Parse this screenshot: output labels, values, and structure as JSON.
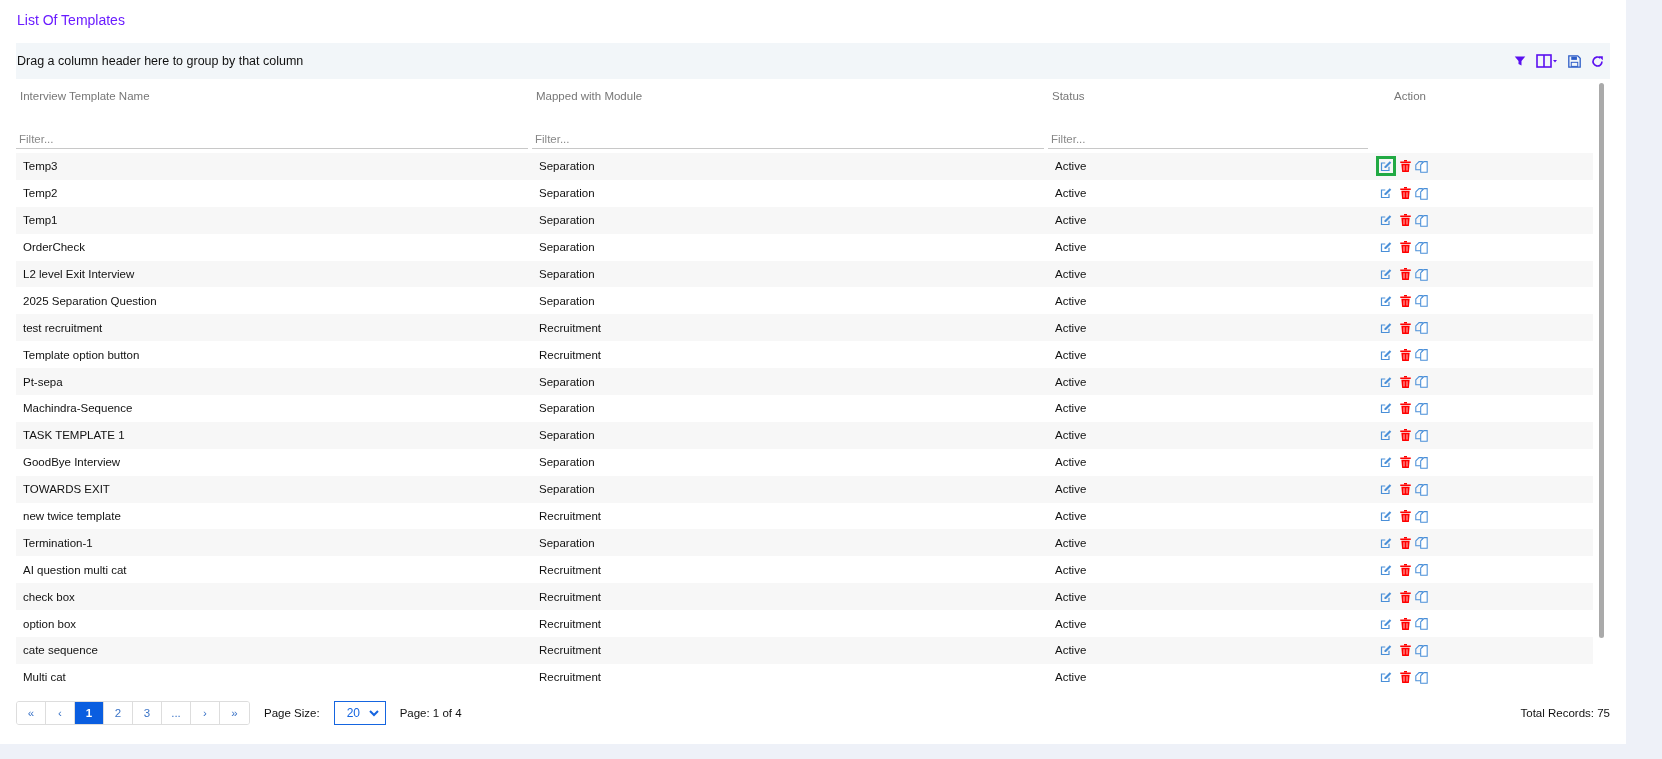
{
  "title": "List Of Templates",
  "group_hint": "Drag a column header here to group by that column",
  "columns": [
    "Interview Template Name",
    "Mapped with Module",
    "Status",
    "Action"
  ],
  "filters": [
    {
      "placeholder": "Filter..."
    },
    {
      "placeholder": "Filter..."
    },
    {
      "placeholder": "Filter..."
    }
  ],
  "rows": [
    {
      "name": "Temp3",
      "module": "Separation",
      "status": "Active",
      "edit_focused": true
    },
    {
      "name": "Temp2",
      "module": "Separation",
      "status": "Active",
      "edit_focused": false
    },
    {
      "name": "Temp1",
      "module": "Separation",
      "status": "Active",
      "edit_focused": false
    },
    {
      "name": "OrderCheck",
      "module": "Separation",
      "status": "Active",
      "edit_focused": false
    },
    {
      "name": "L2 level Exit Interview",
      "module": "Separation",
      "status": "Active",
      "edit_focused": false
    },
    {
      "name": "2025 Separation Question",
      "module": "Separation",
      "status": "Active",
      "edit_focused": false
    },
    {
      "name": "test recruitment",
      "module": "Recruitment",
      "status": "Active",
      "edit_focused": false
    },
    {
      "name": "Template option button",
      "module": "Recruitment",
      "status": "Active",
      "edit_focused": false
    },
    {
      "name": "Pt-sepa",
      "module": "Separation",
      "status": "Active",
      "edit_focused": false
    },
    {
      "name": "Machindra-Sequence",
      "module": "Separation",
      "status": "Active",
      "edit_focused": false
    },
    {
      "name": "TASK TEMPLATE 1",
      "module": "Separation",
      "status": "Active",
      "edit_focused": false
    },
    {
      "name": "GoodBye Interview",
      "module": "Separation",
      "status": "Active",
      "edit_focused": false
    },
    {
      "name": "TOWARDS EXIT",
      "module": "Separation",
      "status": "Active",
      "edit_focused": false
    },
    {
      "name": "new twice template",
      "module": "Recruitment",
      "status": "Active",
      "edit_focused": false
    },
    {
      "name": "Termination-1",
      "module": "Separation",
      "status": "Active",
      "edit_focused": false
    },
    {
      "name": "AI question multi cat",
      "module": "Recruitment",
      "status": "Active",
      "edit_focused": false
    },
    {
      "name": "check box",
      "module": "Recruitment",
      "status": "Active",
      "edit_focused": false
    },
    {
      "name": "option box",
      "module": "Recruitment",
      "status": "Active",
      "edit_focused": false
    },
    {
      "name": "cate sequence",
      "module": "Recruitment",
      "status": "Active",
      "edit_focused": false
    },
    {
      "name": "Multi cat",
      "module": "Recruitment",
      "status": "Active",
      "edit_focused": false
    }
  ],
  "pager": [
    {
      "label": "«",
      "selected": false
    },
    {
      "label": "‹",
      "selected": false
    },
    {
      "label": "1",
      "selected": true
    },
    {
      "label": "2",
      "selected": false
    },
    {
      "label": "3",
      "selected": false
    },
    {
      "label": "...",
      "selected": false
    },
    {
      "label": "›",
      "selected": false
    },
    {
      "label": "»",
      "selected": false
    }
  ],
  "page_size_label": "Page Size:",
  "page_size": "20",
  "page_info": "Page: 1 of 4",
  "total_records": "Total Records: 75"
}
